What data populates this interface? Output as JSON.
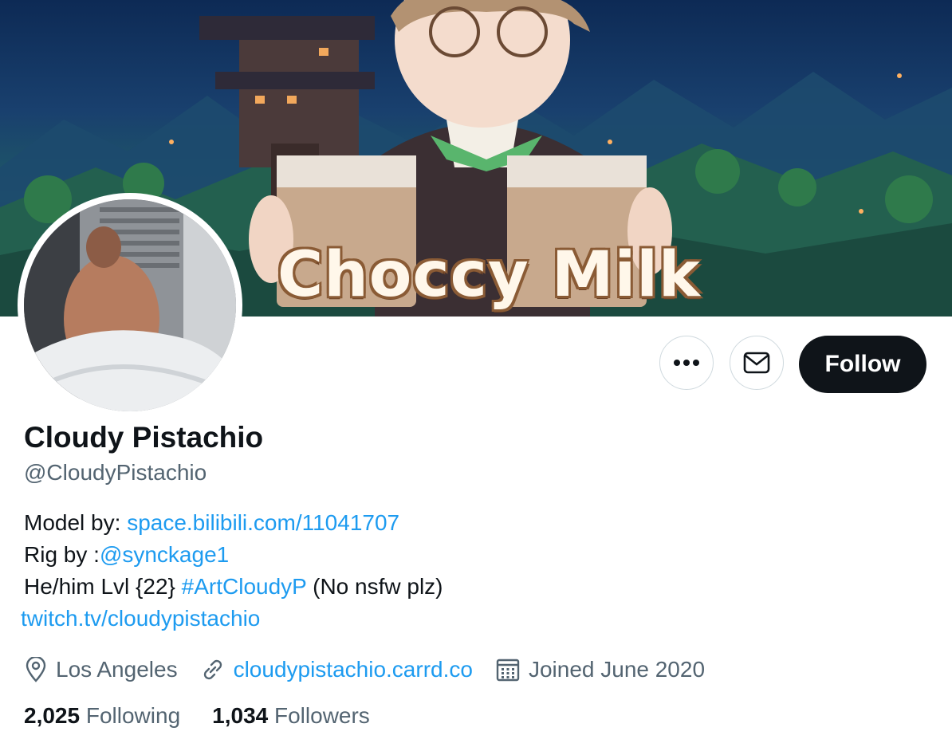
{
  "banner": {
    "text": "Choccy Milk"
  },
  "profile": {
    "display_name": "Cloudy Pistachio",
    "handle": "@CloudyPistachio"
  },
  "actions": {
    "more_icon": "more-icon",
    "message_icon": "mail-icon",
    "follow_label": "Follow"
  },
  "bio": {
    "line1_prefix": "Model by:",
    "line1_link": "space.bilibili.com/11041707",
    "line2_prefix": "Rig by :",
    "line2_link": "@synckage1",
    "line3_prefix": "He/him Lvl {22} ",
    "line3_link": "#ArtCloudyP",
    "line3_suffix": " (No nsfw plz)",
    "line4_link": "twitch.tv/cloudypistachio"
  },
  "meta": {
    "location": "Los Angeles",
    "website": "cloudypistachio.carrd.co",
    "joined": "Joined June 2020"
  },
  "stats": {
    "following_count": "2,025",
    "following_label": "Following",
    "followers_count": "1,034",
    "followers_label": "Followers"
  },
  "colors": {
    "link": "#1d9bf0",
    "text_primary": "#0f1419",
    "text_secondary": "#536471",
    "follow_bg": "#0f1419"
  }
}
